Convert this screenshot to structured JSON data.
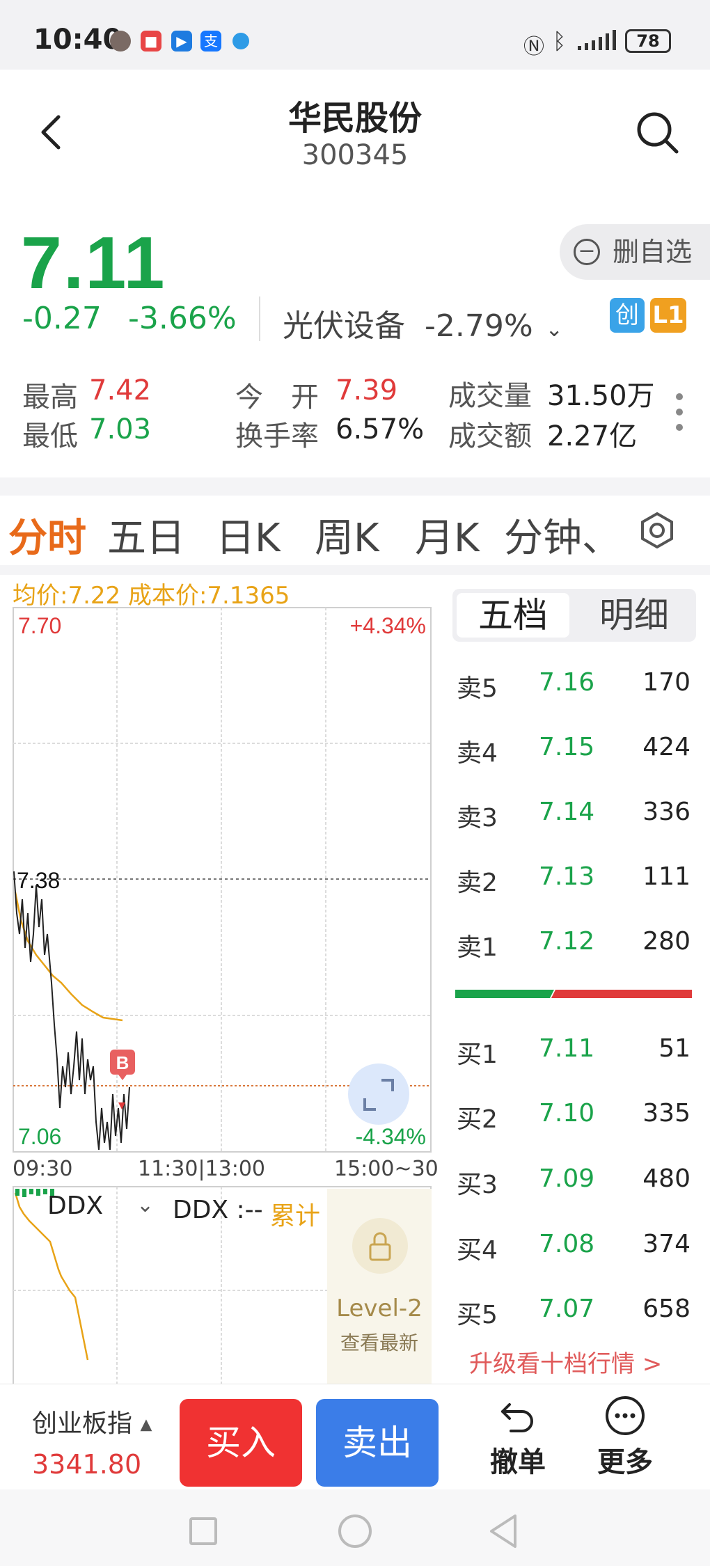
{
  "status": {
    "time": "10:40",
    "battery": "78"
  },
  "header": {
    "name": "华民股份",
    "code": "300345"
  },
  "quote": {
    "price": "7.11",
    "change": "-0.27",
    "change_pct": "-3.66%",
    "sector": "光伏设备",
    "sector_pct": "-2.79%",
    "remove_fav": "删自选",
    "badge_chuang": "创",
    "badge_l1": "L1",
    "stats": {
      "high_label": "最高",
      "high": "7.42",
      "low_label": "最低",
      "low": "7.03",
      "open_label": "今　开",
      "open": "7.39",
      "turnover_label": "换手率",
      "turnover": "6.57%",
      "volume_label": "成交量",
      "volume": "31.50万",
      "amount_label": "成交额",
      "amount": "2.27亿"
    }
  },
  "tabs": [
    "分时",
    "五日",
    "日K",
    "周K",
    "月K",
    "分钟、"
  ],
  "chart": {
    "avg_line_text": "均价:7.22 成本价:7.1365",
    "ymax": "7.70",
    "ymin": "7.06",
    "pct_max": "+4.34%",
    "pct_min": "-4.34%",
    "mid_label": "7.38",
    "x_labels": [
      "09:30",
      "11:30|13:00",
      "15:00~30"
    ],
    "marker": "B",
    "ddx_title": "DDX",
    "ddx_value": "DDX :--",
    "ddx_cum": "累计",
    "level2_title": "Level-2",
    "level2_sub": "查看最新",
    "colors": {
      "price": "#222222",
      "avg": "#e8a317",
      "up": "#e03a3a",
      "down": "#1aa34a"
    }
  },
  "orderbook": {
    "tab_five": "五档",
    "tab_detail": "明细",
    "asks": [
      {
        "label": "卖5",
        "price": "7.16",
        "vol": "170"
      },
      {
        "label": "卖4",
        "price": "7.15",
        "vol": "424"
      },
      {
        "label": "卖3",
        "price": "7.14",
        "vol": "336"
      },
      {
        "label": "卖2",
        "price": "7.13",
        "vol": "111"
      },
      {
        "label": "卖1",
        "price": "7.12",
        "vol": "280"
      }
    ],
    "bids": [
      {
        "label": "买1",
        "price": "7.11",
        "vol": "51"
      },
      {
        "label": "买2",
        "price": "7.10",
        "vol": "335"
      },
      {
        "label": "买3",
        "price": "7.09",
        "vol": "480"
      },
      {
        "label": "买4",
        "price": "7.08",
        "vol": "374"
      },
      {
        "label": "买5",
        "price": "7.07",
        "vol": "658"
      }
    ],
    "upgrade": "升级看十档行情 >"
  },
  "bottom": {
    "index_name": "创业板指",
    "index_value": "3341.80",
    "buy": "买入",
    "sell": "卖出",
    "cancel": "撤单",
    "more": "更多"
  }
}
